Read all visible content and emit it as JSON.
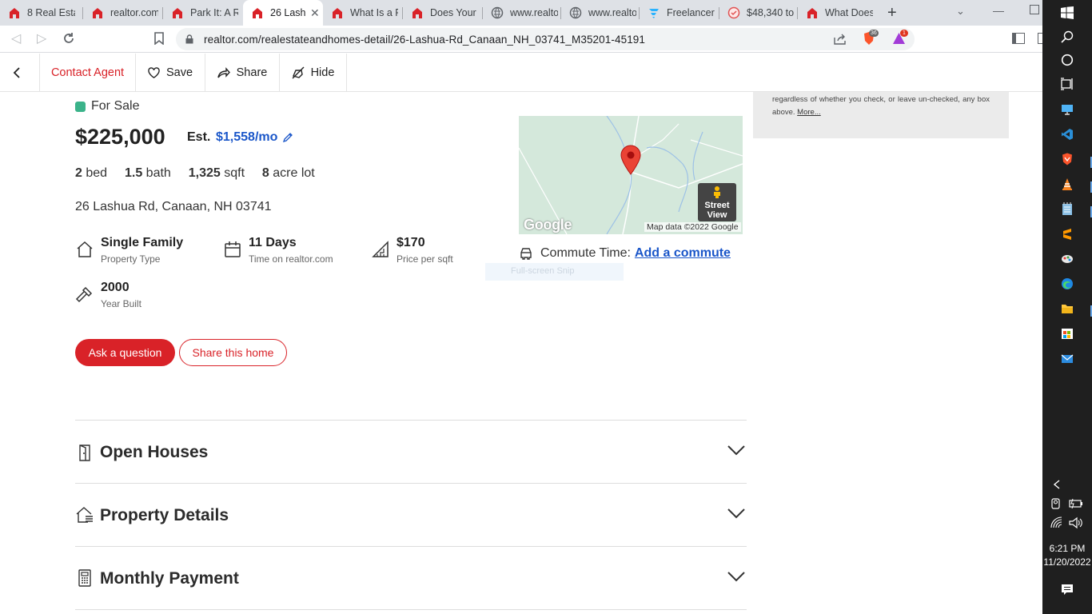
{
  "browser": {
    "tabs": [
      {
        "label": "8 Real Estat",
        "icon": "realtor-icon"
      },
      {
        "label": "realtor.com",
        "icon": "realtor-icon"
      },
      {
        "label": "Park It: A Re",
        "icon": "realtor-icon"
      },
      {
        "label": "26 Lash",
        "icon": "realtor-icon"
      },
      {
        "label": "What Is a P",
        "icon": "realtor-icon"
      },
      {
        "label": "Does Your H",
        "icon": "realtor-icon"
      },
      {
        "label": "www.realtor",
        "icon": "globe-icon"
      },
      {
        "label": "www.realtor",
        "icon": "globe-icon"
      },
      {
        "label": "Freelancer F",
        "icon": "freelancer-icon"
      },
      {
        "label": "$48,340 to ",
        "icon": "shield-icon"
      },
      {
        "label": "What Does",
        "icon": "realtor-icon"
      }
    ],
    "url": "realtor.com/realestateandhomes-detail/26-Lashua-Rd_Canaan_NH_03741_M35201-45191",
    "brave_count": "36",
    "alert_count": "1"
  },
  "subnav": {
    "contact_agent": "Contact Agent",
    "save": "Save",
    "share": "Share",
    "hide": "Hide"
  },
  "listing": {
    "status": "For Sale",
    "status_color": "#3bb38a",
    "price": "$225,000",
    "est_label": "Est.",
    "est_payment": "$1,558/mo",
    "beds": "2",
    "beds_label": "bed",
    "baths": "1.5",
    "baths_label": "bath",
    "sqft": "1,325",
    "sqft_label": "sqft",
    "lot": "8",
    "lot_label": "acre lot",
    "address": "26 Lashua Rd, Canaan, NH 03741",
    "facts": [
      {
        "value": "Single Family",
        "label": "Property Type",
        "icon": "house-icon"
      },
      {
        "value": "11 Days",
        "label": "Time on realtor.com",
        "icon": "calendar-icon"
      },
      {
        "value": "$170",
        "label": "Price per sqft",
        "icon": "ruler-icon"
      },
      {
        "value": "2000",
        "label": "Year Built",
        "icon": "hammer-icon"
      }
    ],
    "ask_button": "Ask a question",
    "share_button": "Share this home"
  },
  "map": {
    "google_label": "Google",
    "street_view_label_1": "Street",
    "street_view_label_2": "View",
    "attribution": "Map data ©2022 Google",
    "commute_label": "Commute Time:",
    "commute_link": "Add a commute"
  },
  "snip_overlay": "Full-screen Snip",
  "disclaimer": {
    "text": "regardless of whether you check, or leave un-checked, any box above.",
    "more": "More..."
  },
  "accordions": [
    {
      "title": "Open Houses",
      "icon": "door-icon"
    },
    {
      "title": "Property Details",
      "icon": "house-list-icon"
    },
    {
      "title": "Monthly Payment",
      "icon": "calculator-icon"
    }
  ],
  "taskbar": {
    "time": "6:21 PM",
    "date": "11/20/2022"
  },
  "colors": {
    "brand_red": "#d92228",
    "link_blue": "#1a56c9",
    "map_green": "#d4e8db"
  }
}
